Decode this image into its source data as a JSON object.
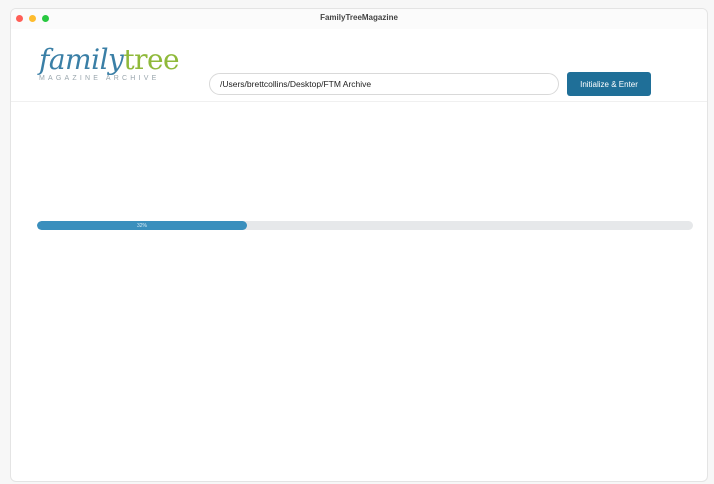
{
  "window": {
    "title": "FamilyTreeMagazine",
    "controls": [
      {
        "name": "close",
        "color": "#ff5f57"
      },
      {
        "name": "minimize",
        "color": "#febc2e"
      },
      {
        "name": "zoom",
        "color": "#28c840"
      }
    ]
  },
  "logo": {
    "word_family": "family",
    "word_tree": "tree",
    "subtitle": "MAGAZINE ARCHIVE"
  },
  "path_input": {
    "value": "/Users/brettcollins/Desktop/FTM Archive"
  },
  "init_button": {
    "label": "Initialize & Enter",
    "color": "#1f6f98"
  },
  "progress": {
    "percent": 32,
    "label": "32%",
    "fill_color": "#3a8fbd"
  }
}
